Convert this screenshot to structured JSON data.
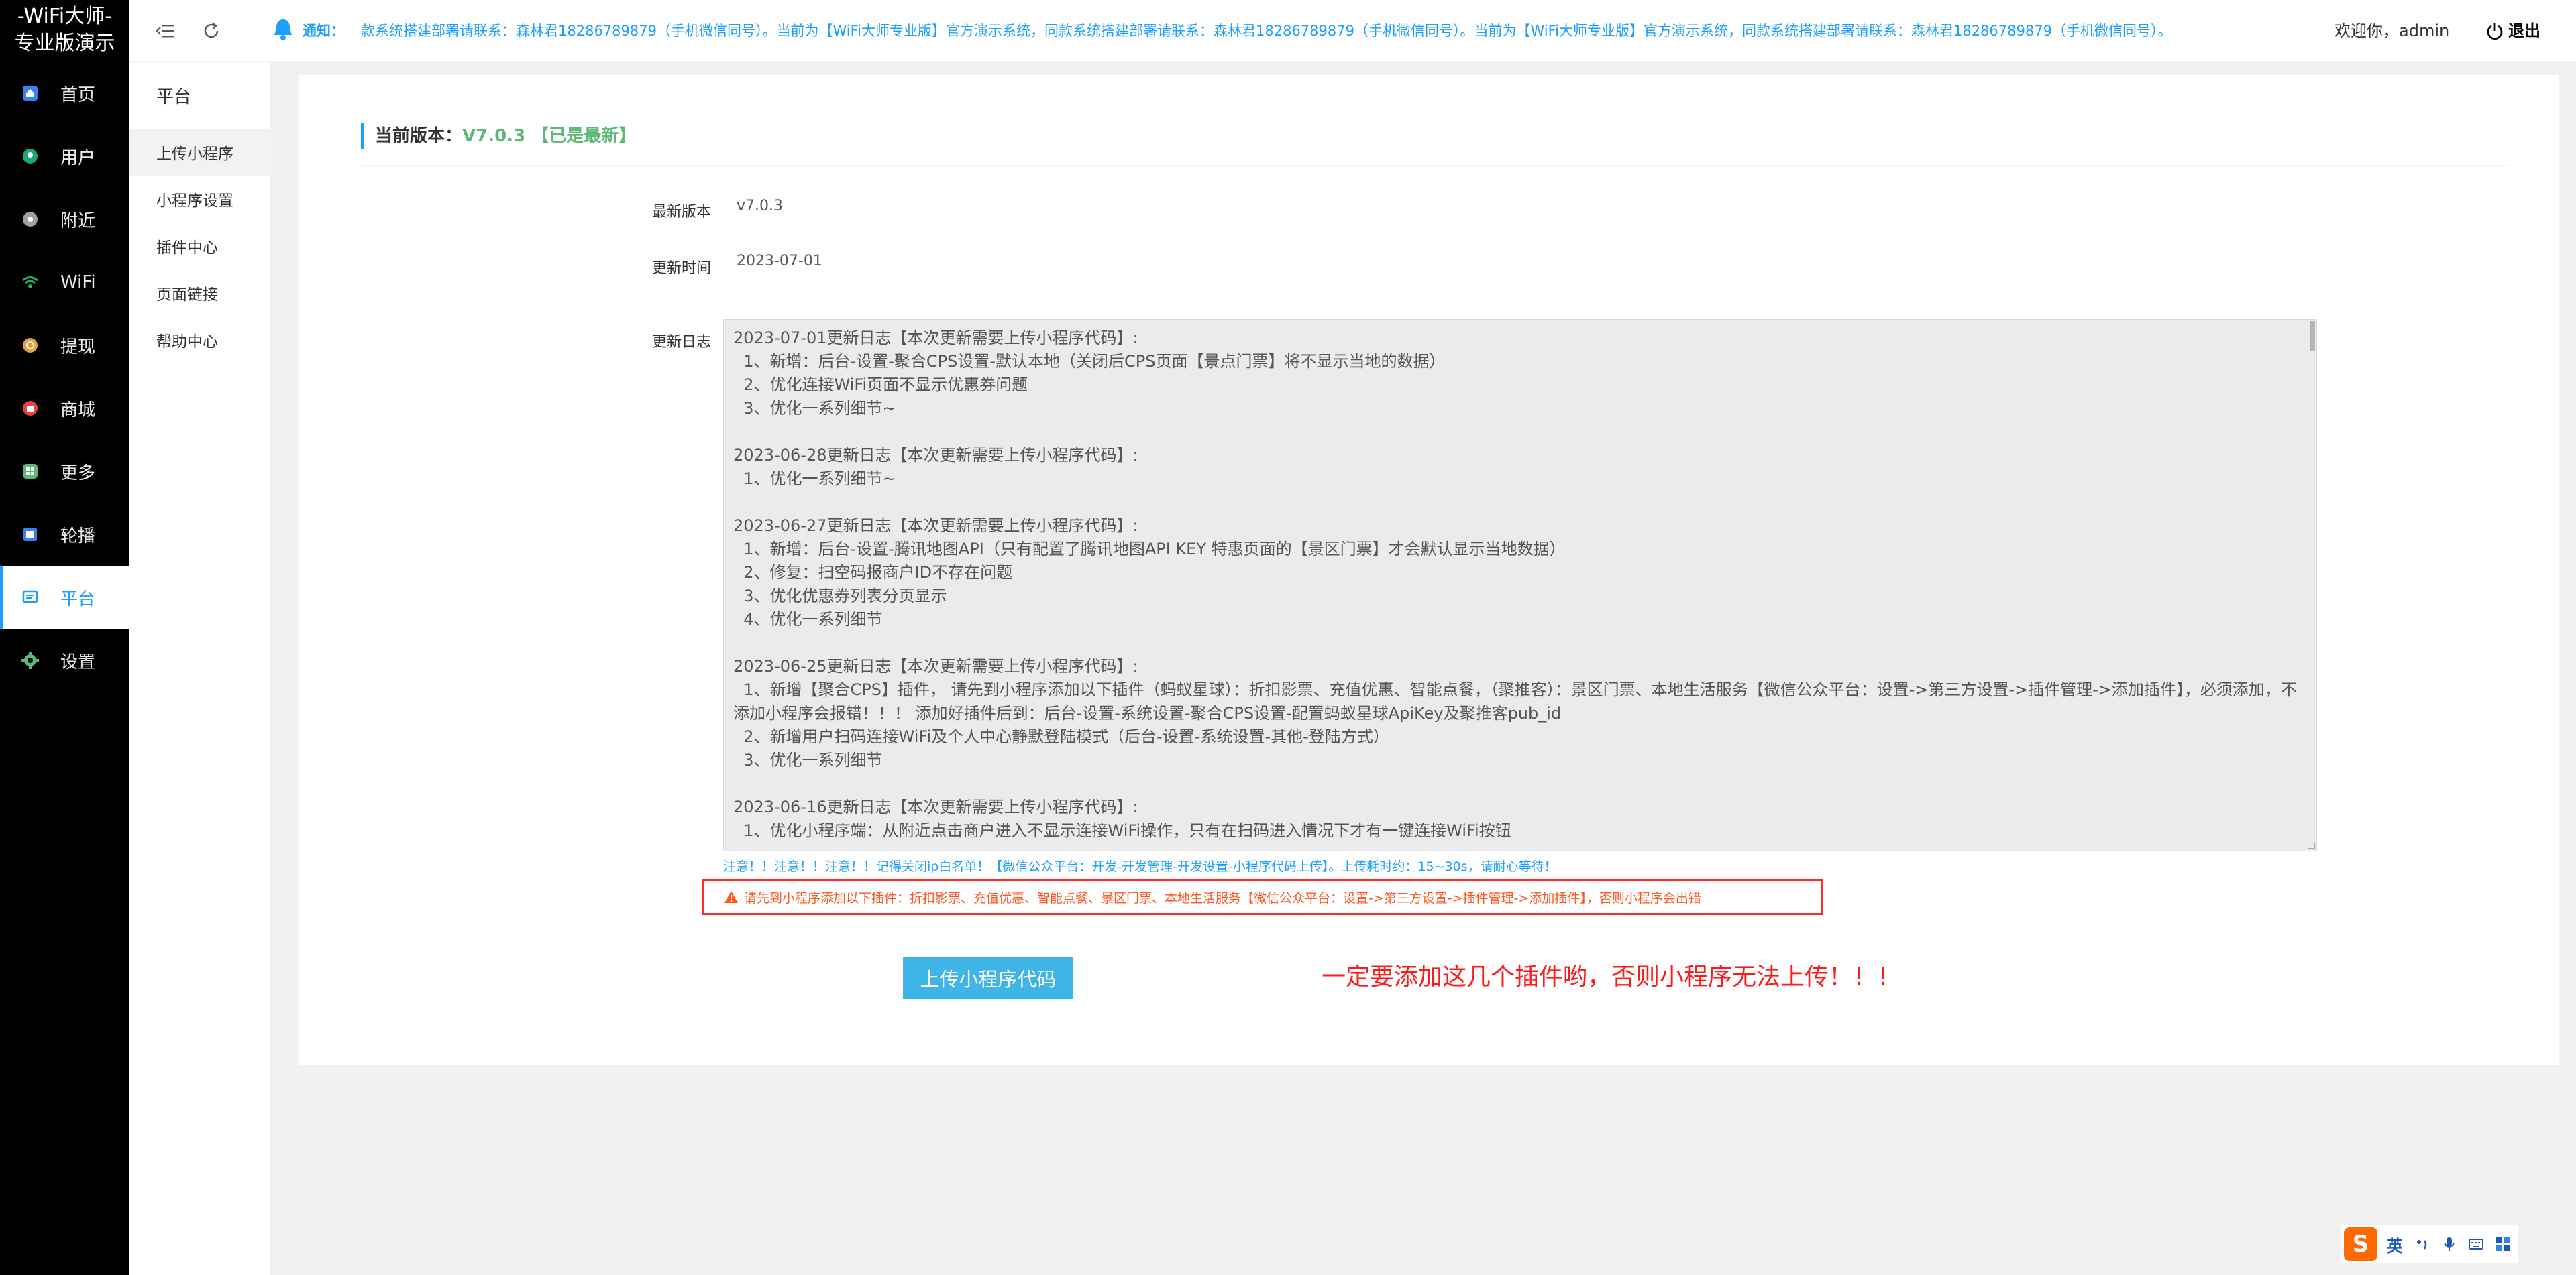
{
  "app": {
    "logo_line1": "-WiFi大师-",
    "logo_line2": "专业版演示"
  },
  "sidebar": {
    "items": [
      {
        "label": "首页",
        "icon": "home-icon",
        "color": "#3b7ff5"
      },
      {
        "label": "用户",
        "icon": "user-icon",
        "color": "#1aa97b"
      },
      {
        "label": "附近",
        "icon": "location-icon",
        "color": "#9aa0a6"
      },
      {
        "label": "WiFi",
        "icon": "wifi-icon",
        "color": "#1fb45a"
      },
      {
        "label": "提现",
        "icon": "withdraw-icon",
        "color": "#e6a23c"
      },
      {
        "label": "商城",
        "icon": "shop-icon",
        "color": "#e64340"
      },
      {
        "label": "更多",
        "icon": "more-icon",
        "color": "#5fb878"
      },
      {
        "label": "轮播",
        "icon": "carousel-icon",
        "color": "#3b7ff5"
      },
      {
        "label": "平台",
        "icon": "platform-icon",
        "color": "#1e9fff",
        "active": true
      },
      {
        "label": "设置",
        "icon": "settings-icon",
        "color": "#5fb878"
      }
    ]
  },
  "subnav": {
    "title": "平台",
    "items": [
      {
        "label": "上传小程序",
        "active": true
      },
      {
        "label": "小程序设置"
      },
      {
        "label": "插件中心"
      },
      {
        "label": "页面链接"
      },
      {
        "label": "帮助中心"
      }
    ]
  },
  "header": {
    "notice_label": "通知：",
    "marquee": "款系统搭建部署请联系：森林君18286789879（手机微信同号）。当前为【WiFi大师专业版】官方演示系统，同款系统搭建部署请联系：森林君18286789879（手机微信同号）。当前为【WiFi大师专业版】官方演示系统，同款系统搭建部署请联系：森林君18286789879（手机微信同号）。",
    "welcome": "欢迎你，admin",
    "logout": "退出"
  },
  "main": {
    "version_prefix": "当前版本：",
    "version_value": "V7.0.3 【已是最新】",
    "fields": {
      "latest_label": "最新版本",
      "latest_value": "v7.0.3",
      "time_label": "更新时间",
      "time_value": "2023-07-01",
      "log_label": "更新日志"
    },
    "log": [
      {
        "head": "2023-07-01更新日志【本次更新需要上传小程序代码】:",
        "lines": [
          "  1、新增：后台-设置-聚合CPS设置-默认本地（关闭后CPS页面【景点门票】将不显示当地的数据）",
          "  2、优化连接WiFi页面不显示优惠券问题",
          "  3、优化一系列细节~"
        ]
      },
      {
        "head": "2023-06-28更新日志【本次更新需要上传小程序代码】:",
        "lines": [
          "  1、优化一系列细节~"
        ]
      },
      {
        "head": "2023-06-27更新日志【本次更新需要上传小程序代码】:",
        "lines": [
          "  1、新增：后台-设置-腾讯地图API（只有配置了腾讯地图API KEY 特惠页面的【景区门票】才会默认显示当地数据）",
          "  2、修复：扫空码报商户ID不存在问题",
          "  3、优化优惠券列表分页显示",
          "  4、优化一系列细节"
        ]
      },
      {
        "head": "2023-06-25更新日志【本次更新需要上传小程序代码】:",
        "lines": [
          "  1、新增【聚合CPS】插件， 请先到小程序添加以下插件（蚂蚁星球）：折扣影票、充值优惠、智能点餐，（聚推客）：景区门票、本地生活服务【微信公众平台：设置->第三方设置->插件管理->添加插件】，必须添加，不添加小程序会报错！！！ 添加好插件后到：后台-设置-系统设置-聚合CPS设置-配置蚂蚁星球ApiKey及聚推客pub_id",
          "  2、新增用户扫码连接WiFi及个人中心静默登陆模式（后台-设置-系统设置-其他-登陆方式）",
          "  3、优化一系列细节"
        ]
      },
      {
        "head": "2023-06-16更新日志【本次更新需要上传小程序代码】:",
        "lines": [
          "  1、优化小程序端：从附近点击商户进入不显示连接WiFi操作，只有在扫码进入情况下才有一键连接WiFi按钮"
        ]
      }
    ],
    "warn_line": "注意！！注意！！注意！！记得关闭ip白名单！【微信公众平台：开发-开发管理-开发设置-小程序代码上传】。上传耗时约：15~30s，请耐心等待！",
    "alert_text": "请先到小程序添加以下插件：折扣影票、充值优惠、智能点餐、景区门票、本地生活服务【微信公众平台：设置->第三方设置->插件管理->添加插件】，否则小程序会出错",
    "upload_button": "上传小程序代码",
    "red_note": "一定要添加这几个插件哟，否则小程序无法上传！！！"
  },
  "ime": {
    "logo": "S",
    "lang": "英"
  }
}
